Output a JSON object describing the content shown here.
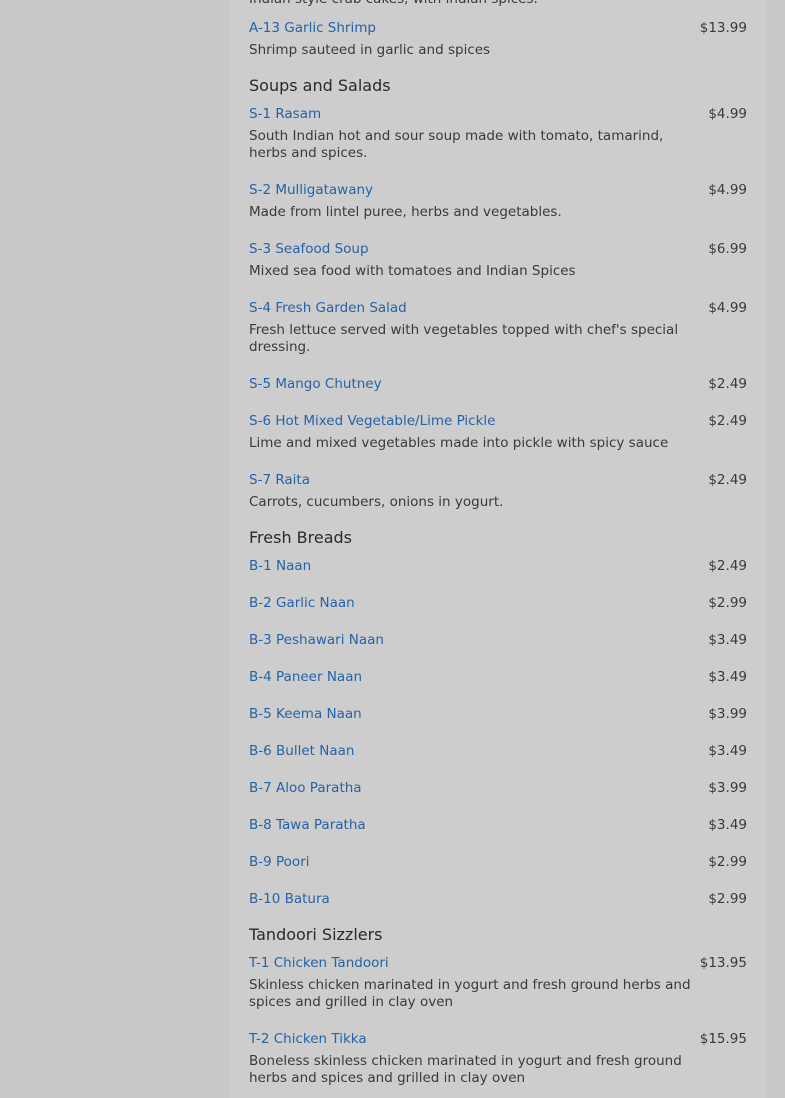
{
  "lead_desc": "Indian style crab cakes, with indian spices.",
  "first_item": {
    "name": "A-13 Garlic Shrimp",
    "price": "$13.99",
    "desc": "Shrimp sauteed in garlic and spices"
  },
  "sections": [
    {
      "title": "Soups and Salads",
      "items": [
        {
          "name": "S-1 Rasam",
          "price": "$4.99",
          "desc": "South Indian hot and sour soup made with tomato, tamarind, herbs and spices."
        },
        {
          "name": "S-2 Mulligatawany",
          "price": "$4.99",
          "desc": "Made from lintel puree, herbs and vegetables."
        },
        {
          "name": "S-3 Seafood Soup",
          "price": "$6.99",
          "desc": "Mixed sea food with tomatoes and Indian Spices"
        },
        {
          "name": "S-4 Fresh Garden Salad",
          "price": "$4.99",
          "desc": "Fresh lettuce served with vegetables topped with chef's special dressing."
        },
        {
          "name": "S-5 Mango Chutney",
          "price": "$2.49",
          "desc": ""
        },
        {
          "name": "S-6 Hot Mixed Vegetable/Lime Pickle",
          "price": "$2.49",
          "desc": "Lime and mixed vegetables made into pickle with spicy sauce"
        },
        {
          "name": "S-7 Raita",
          "price": "$2.49",
          "desc": "Carrots, cucumbers, onions in yogurt."
        }
      ]
    },
    {
      "title": "Fresh Breads",
      "items": [
        {
          "name": "B-1 Naan",
          "price": "$2.49",
          "desc": ""
        },
        {
          "name": "B-2 Garlic Naan",
          "price": "$2.99",
          "desc": ""
        },
        {
          "name": "B-3 Peshawari Naan",
          "price": "$3.49",
          "desc": ""
        },
        {
          "name": "B-4 Paneer Naan",
          "price": "$3.49",
          "desc": ""
        },
        {
          "name": "B-5 Keema Naan",
          "price": "$3.99",
          "desc": ""
        },
        {
          "name": "B-6 Bullet Naan",
          "price": "$3.49",
          "desc": ""
        },
        {
          "name": "B-7 Aloo Paratha",
          "price": "$3.99",
          "desc": ""
        },
        {
          "name": "B-8 Tawa Paratha",
          "price": "$3.49",
          "desc": ""
        },
        {
          "name": "B-9 Poori",
          "price": "$2.99",
          "desc": ""
        },
        {
          "name": "B-10 Batura",
          "price": "$2.99",
          "desc": ""
        }
      ]
    },
    {
      "title": "Tandoori Sizzlers",
      "items": [
        {
          "name": "T-1 Chicken Tandoori",
          "price": "$13.95",
          "desc": "Skinless chicken marinated in yogurt and fresh ground herbs and spices and grilled in clay oven"
        },
        {
          "name": "T-2 Chicken Tikka",
          "price": "$15.95",
          "desc": "Boneless skinless chicken marinated in yogurt and fresh ground herbs and spices and grilled in clay oven"
        }
      ]
    }
  ]
}
